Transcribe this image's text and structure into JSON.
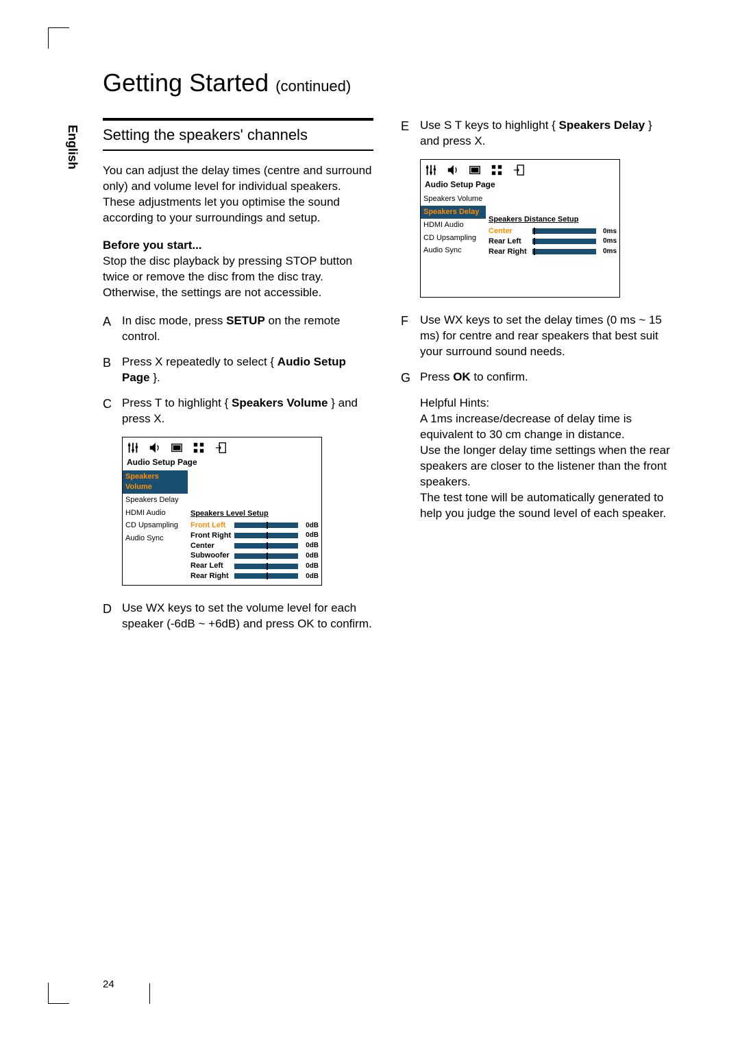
{
  "header": {
    "title": "Getting Started",
    "continued": "(continued)"
  },
  "sidebar": "English",
  "pageNumber": "24",
  "left": {
    "sectionTitle": "Setting the speakers' channels",
    "intro": "You can adjust the delay times (centre and surround only) and volume level for individual speakers. These adjustments let you optimise the sound according to your surroundings and setup.",
    "beforeTitle": "Before you start...",
    "beforeBody": "Stop the disc playback by pressing STOP button twice or remove the disc from the disc tray. Otherwise, the settings are not accessible.",
    "A": {
      "pre": "In disc mode, press ",
      "bold": "SETUP",
      "post": " on the remote control."
    },
    "B": {
      "pre": "Press  X repeatedly to select { ",
      "bold": "Audio Setup Page",
      "post": " }."
    },
    "C": {
      "pre": "Press  T to highlight { ",
      "bold": "Speakers Volume",
      "post": " } and press  X."
    },
    "D": "Use  WX keys to set the volume level for each speaker (-6dB ~ +6dB) and press OK to confirm."
  },
  "right": {
    "E": {
      "pre": "Use  S T keys to highlight { ",
      "bold": "Speakers Delay",
      "post": " } and press  X."
    },
    "F": "Use  WX keys to set the delay times (0 ms ~ 15 ms) for centre and rear speakers that best suit your surround sound needs.",
    "G": {
      "pre": "Press ",
      "bold": "OK",
      "post": " to confirm."
    },
    "hintsTitle": "Helpful Hints:",
    "hints": [
      "  A 1ms increase/decrease of delay time is equivalent to 30 cm change in distance.",
      "  Use the longer delay time settings when the rear speakers are closer to the listener than the front speakers.",
      "  The test tone will be automatically generated to help you judge the sound level of each speaker."
    ]
  },
  "panelA": {
    "title": "Audio Setup Page",
    "leftItems": [
      "Speakers Volume",
      "Speakers Delay",
      "HDMI Audio",
      "CD Upsampling",
      "Audio Sync"
    ],
    "selectedIndex": 0,
    "rightTitle": "Speakers Level Setup",
    "rows": [
      {
        "label": "Front Left",
        "val": "0dB",
        "hl": true
      },
      {
        "label": "Front Right",
        "val": "0dB"
      },
      {
        "label": "Center",
        "val": "0dB"
      },
      {
        "label": "Subwoofer",
        "val": "0dB"
      },
      {
        "label": "Rear Left",
        "val": "0dB"
      },
      {
        "label": "Rear Right",
        "val": "0dB"
      }
    ]
  },
  "panelB": {
    "title": "Audio Setup Page",
    "leftItems": [
      "Speakers Volume",
      "Speakers Delay",
      "HDMI Audio",
      "CD Upsampling",
      "Audio Sync"
    ],
    "selectedIndex": 1,
    "rightTitle": "Speakers Distance Setup",
    "rows": [
      {
        "label": "Center",
        "val": "0ms",
        "hl": true
      },
      {
        "label": "Rear Left",
        "val": "0ms"
      },
      {
        "label": "Rear Right",
        "val": "0ms"
      }
    ]
  }
}
